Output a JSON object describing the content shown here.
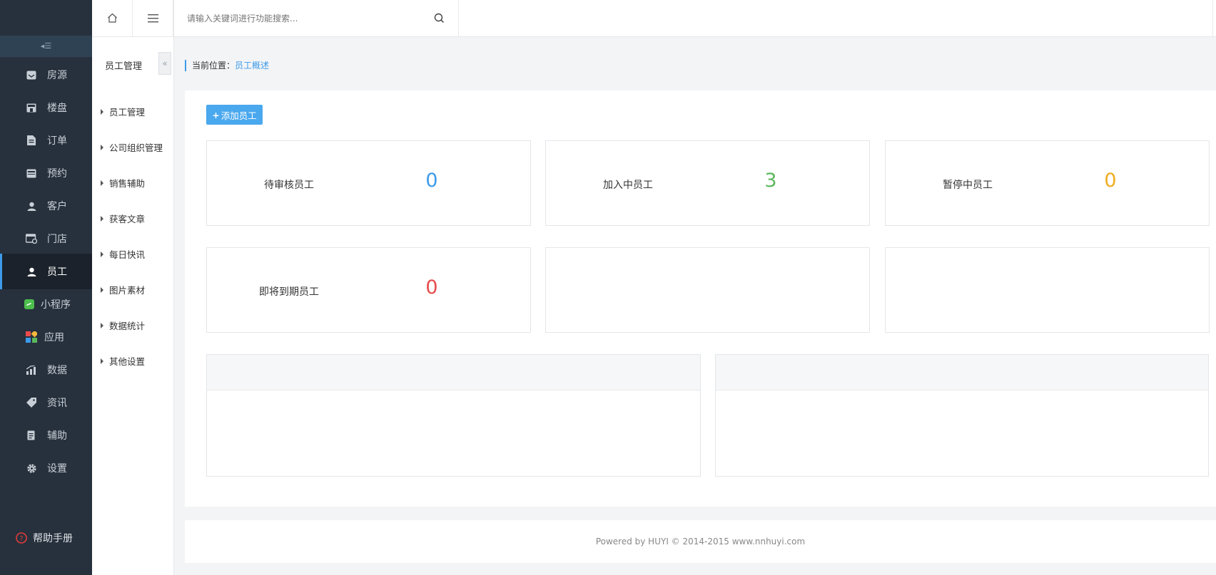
{
  "sidebar": {
    "collapse_glyph": "◂☰",
    "items": [
      {
        "label": "房源",
        "icon": "house-icon"
      },
      {
        "label": "楼盘",
        "icon": "building-icon"
      },
      {
        "label": "订单",
        "icon": "order-icon"
      },
      {
        "label": "预约",
        "icon": "calendar-icon"
      },
      {
        "label": "客户",
        "icon": "customer-icon"
      },
      {
        "label": "门店",
        "icon": "store-icon"
      },
      {
        "label": "员工",
        "icon": "staff-icon",
        "active": true
      },
      {
        "label": "小程序",
        "icon": "miniprogram-icon"
      },
      {
        "label": "应用",
        "icon": "apps-icon"
      },
      {
        "label": "数据",
        "icon": "chart-icon"
      },
      {
        "label": "资讯",
        "icon": "tag-icon"
      },
      {
        "label": "辅助",
        "icon": "assist-icon"
      },
      {
        "label": "设置",
        "icon": "gear-icon"
      },
      {
        "label": "帮助手册",
        "icon": "help-icon"
      }
    ]
  },
  "submenu": {
    "title": "员工管理",
    "fold_glyph": "«",
    "items": [
      "员工管理",
      "公司组织管理",
      "销售辅助",
      "获客文章",
      "每日快讯",
      "图片素材",
      "数据统计",
      "其他设置"
    ]
  },
  "search": {
    "placeholder": "请输入关键词进行功能搜索..."
  },
  "breadcrumb": {
    "prefix": "当前位置：",
    "current": "员工概述"
  },
  "actions": {
    "add_label": "添加员工"
  },
  "stats": [
    {
      "label": "待审核员工",
      "value": "0",
      "color": "#3d9be9"
    },
    {
      "label": "加入中员工",
      "value": "3",
      "color": "#5cb85c"
    },
    {
      "label": "暂停中员工",
      "value": "0",
      "color": "#f0ad20"
    },
    {
      "label": "即将到期员工",
      "value": "0",
      "color": "#e74c4c"
    }
  ],
  "footer": {
    "text": "Powered by HUYI © 2014-2015 www.nnhuyi.com"
  }
}
